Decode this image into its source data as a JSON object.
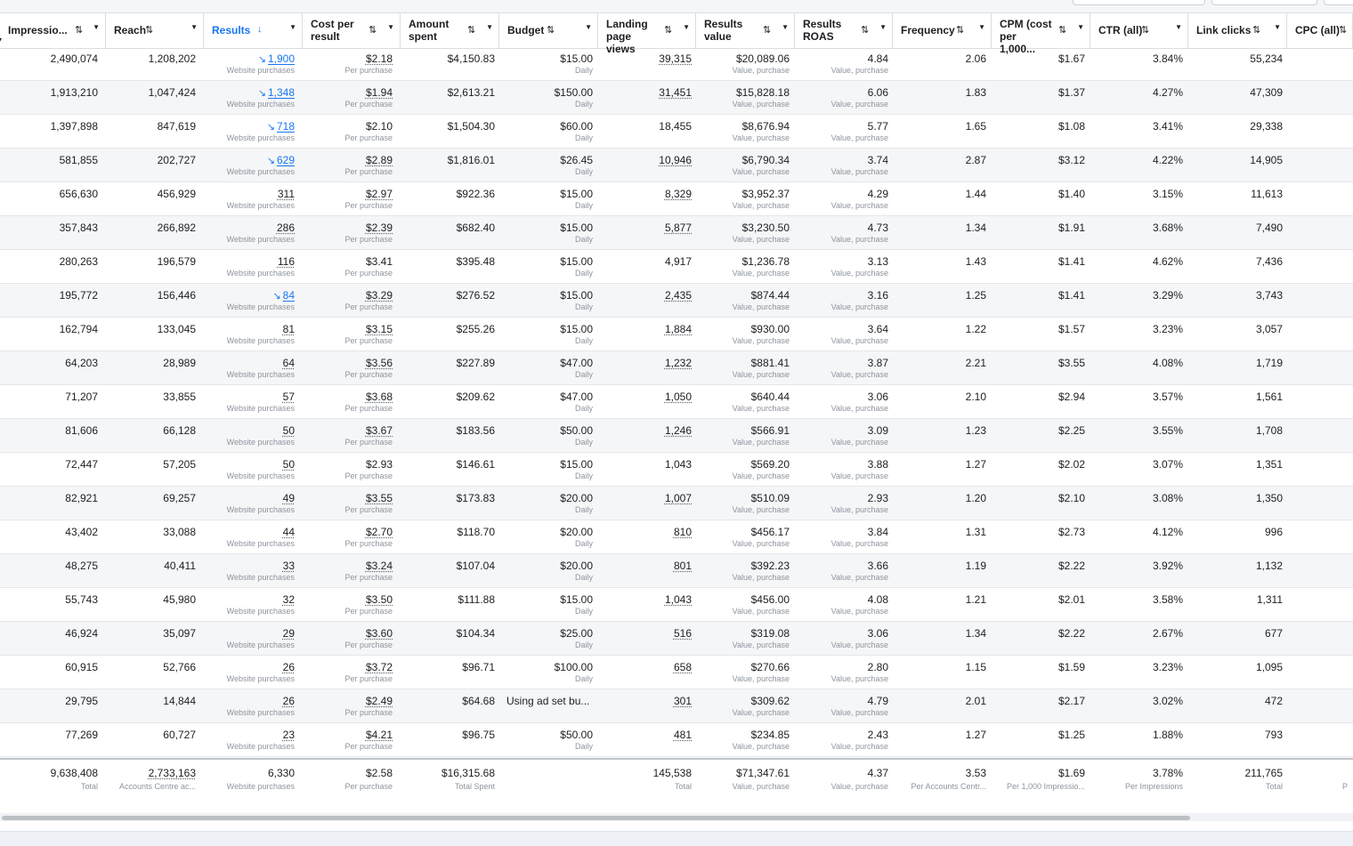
{
  "columns": [
    {
      "label": "Impressio...",
      "sort": "⇅",
      "caret": true
    },
    {
      "label": "Reach",
      "sort": "⇅",
      "caret": true
    },
    {
      "label": "Results",
      "sort": "↓",
      "caret": true,
      "active": true
    },
    {
      "label": "Cost per result",
      "sort": "⇅",
      "caret": true
    },
    {
      "label": "Amount spent",
      "sort": "⇅",
      "caret": true
    },
    {
      "label": "Budget",
      "sort": "⇅",
      "caret": true
    },
    {
      "label": "Landing page views",
      "sort": "⇅",
      "caret": true
    },
    {
      "label": "Results value",
      "sort": "⇅",
      "caret": true
    },
    {
      "label": "Results ROAS",
      "sort": "⇅",
      "caret": true
    },
    {
      "label": "Frequency",
      "sort": "⇅",
      "caret": true
    },
    {
      "label": "CPM (cost per 1,000...",
      "sort": "⇅",
      "caret": true
    },
    {
      "label": "CTR (all)",
      "sort": "⇅",
      "caret": true
    },
    {
      "label": "Link clicks",
      "sort": "⇅",
      "caret": true
    },
    {
      "label": "CPC (all)",
      "sort": "⇅",
      "caret": false
    }
  ],
  "sublabels": {
    "results": "Website purchases",
    "cost_per_result": "Per purchase",
    "budget": "Daily",
    "results_value": "Value, purchase",
    "roas": "Value, purchase"
  },
  "rows": [
    {
      "imp": "2,490,074",
      "reach": "1,208,202",
      "results": "1,900",
      "res_trend": true,
      "res_style": "link",
      "cpr": "$2.18",
      "cpr_dot": true,
      "spent": "$4,150.83",
      "budget": "$15.00",
      "budget_sub": true,
      "lpv": "39,315",
      "lpv_dot": true,
      "value": "$20,089.06",
      "roas": "4.84",
      "freq": "2.06",
      "cpm": "$1.67",
      "ctr": "3.84%",
      "clicks": "55,234"
    },
    {
      "imp": "1,913,210",
      "reach": "1,047,424",
      "results": "1,348",
      "res_trend": true,
      "res_style": "link",
      "cpr": "$1.94",
      "cpr_dot": true,
      "spent": "$2,613.21",
      "budget": "$150.00",
      "budget_sub": true,
      "lpv": "31,451",
      "lpv_dot": true,
      "value": "$15,828.18",
      "roas": "6.06",
      "freq": "1.83",
      "cpm": "$1.37",
      "ctr": "4.27%",
      "clicks": "47,309"
    },
    {
      "imp": "1,397,898",
      "reach": "847,619",
      "results": "718",
      "res_trend": true,
      "res_style": "link",
      "cpr": "$2.10",
      "cpr_dot": false,
      "spent": "$1,504.30",
      "budget": "$60.00",
      "budget_sub": true,
      "lpv": "18,455",
      "lpv_dot": false,
      "value": "$8,676.94",
      "roas": "5.77",
      "freq": "1.65",
      "cpm": "$1.08",
      "ctr": "3.41%",
      "clicks": "29,338"
    },
    {
      "imp": "581,855",
      "reach": "202,727",
      "results": "629",
      "res_trend": true,
      "res_style": "link",
      "cpr": "$2.89",
      "cpr_dot": true,
      "spent": "$1,816.01",
      "budget": "$26.45",
      "budget_sub": true,
      "lpv": "10,946",
      "lpv_dot": true,
      "value": "$6,790.34",
      "roas": "3.74",
      "freq": "2.87",
      "cpm": "$3.12",
      "ctr": "4.22%",
      "clicks": "14,905"
    },
    {
      "imp": "656,630",
      "reach": "456,929",
      "results": "311",
      "res_trend": false,
      "res_style": "dot",
      "cpr": "$2.97",
      "cpr_dot": true,
      "spent": "$922.36",
      "budget": "$15.00",
      "budget_sub": true,
      "lpv": "8,329",
      "lpv_dot": true,
      "value": "$3,952.37",
      "roas": "4.29",
      "freq": "1.44",
      "cpm": "$1.40",
      "ctr": "3.15%",
      "clicks": "11,613"
    },
    {
      "imp": "357,843",
      "reach": "266,892",
      "results": "286",
      "res_trend": false,
      "res_style": "dot",
      "cpr": "$2.39",
      "cpr_dot": true,
      "spent": "$682.40",
      "budget": "$15.00",
      "budget_sub": true,
      "lpv": "5,877",
      "lpv_dot": true,
      "value": "$3,230.50",
      "roas": "4.73",
      "freq": "1.34",
      "cpm": "$1.91",
      "ctr": "3.68%",
      "clicks": "7,490"
    },
    {
      "imp": "280,263",
      "reach": "196,579",
      "results": "116",
      "res_trend": false,
      "res_style": "dot",
      "cpr": "$3.41",
      "cpr_dot": false,
      "spent": "$395.48",
      "budget": "$15.00",
      "budget_sub": true,
      "lpv": "4,917",
      "lpv_dot": false,
      "value": "$1,236.78",
      "roas": "3.13",
      "freq": "1.43",
      "cpm": "$1.41",
      "ctr": "4.62%",
      "clicks": "7,436"
    },
    {
      "imp": "195,772",
      "reach": "156,446",
      "results": "84",
      "res_trend": true,
      "res_style": "link",
      "cpr": "$3.29",
      "cpr_dot": true,
      "spent": "$276.52",
      "budget": "$15.00",
      "budget_sub": true,
      "lpv": "2,435",
      "lpv_dot": true,
      "value": "$874.44",
      "roas": "3.16",
      "freq": "1.25",
      "cpm": "$1.41",
      "ctr": "3.29%",
      "clicks": "3,743"
    },
    {
      "imp": "162,794",
      "reach": "133,045",
      "results": "81",
      "res_trend": false,
      "res_style": "dot",
      "cpr": "$3.15",
      "cpr_dot": true,
      "spent": "$255.26",
      "budget": "$15.00",
      "budget_sub": true,
      "lpv": "1,884",
      "lpv_dot": true,
      "value": "$930.00",
      "roas": "3.64",
      "freq": "1.22",
      "cpm": "$1.57",
      "ctr": "3.23%",
      "clicks": "3,057"
    },
    {
      "imp": "64,203",
      "reach": "28,989",
      "results": "64",
      "res_trend": false,
      "res_style": "dot",
      "cpr": "$3.56",
      "cpr_dot": true,
      "spent": "$227.89",
      "budget": "$47.00",
      "budget_sub": true,
      "lpv": "1,232",
      "lpv_dot": true,
      "value": "$881.41",
      "roas": "3.87",
      "freq": "2.21",
      "cpm": "$3.55",
      "ctr": "4.08%",
      "clicks": "1,719"
    },
    {
      "imp": "71,207",
      "reach": "33,855",
      "results": "57",
      "res_trend": false,
      "res_style": "dot",
      "cpr": "$3.68",
      "cpr_dot": true,
      "spent": "$209.62",
      "budget": "$47.00",
      "budget_sub": true,
      "lpv": "1,050",
      "lpv_dot": true,
      "value": "$640.44",
      "roas": "3.06",
      "freq": "2.10",
      "cpm": "$2.94",
      "ctr": "3.57%",
      "clicks": "1,561"
    },
    {
      "imp": "81,606",
      "reach": "66,128",
      "results": "50",
      "res_trend": false,
      "res_style": "dot",
      "cpr": "$3.67",
      "cpr_dot": true,
      "spent": "$183.56",
      "budget": "$50.00",
      "budget_sub": true,
      "lpv": "1,246",
      "lpv_dot": true,
      "value": "$566.91",
      "roas": "3.09",
      "freq": "1.23",
      "cpm": "$2.25",
      "ctr": "3.55%",
      "clicks": "1,708"
    },
    {
      "imp": "72,447",
      "reach": "57,205",
      "results": "50",
      "res_trend": false,
      "res_style": "dot",
      "cpr": "$2.93",
      "cpr_dot": false,
      "spent": "$146.61",
      "budget": "$15.00",
      "budget_sub": true,
      "lpv": "1,043",
      "lpv_dot": false,
      "value": "$569.20",
      "roas": "3.88",
      "freq": "1.27",
      "cpm": "$2.02",
      "ctr": "3.07%",
      "clicks": "1,351"
    },
    {
      "imp": "82,921",
      "reach": "69,257",
      "results": "49",
      "res_trend": false,
      "res_style": "dot",
      "cpr": "$3.55",
      "cpr_dot": true,
      "spent": "$173.83",
      "budget": "$20.00",
      "budget_sub": true,
      "lpv": "1,007",
      "lpv_dot": true,
      "value": "$510.09",
      "roas": "2.93",
      "freq": "1.20",
      "cpm": "$2.10",
      "ctr": "3.08%",
      "clicks": "1,350"
    },
    {
      "imp": "43,402",
      "reach": "33,088",
      "results": "44",
      "res_trend": false,
      "res_style": "dot",
      "cpr": "$2.70",
      "cpr_dot": true,
      "spent": "$118.70",
      "budget": "$20.00",
      "budget_sub": true,
      "lpv": "810",
      "lpv_dot": true,
      "value": "$456.17",
      "roas": "3.84",
      "freq": "1.31",
      "cpm": "$2.73",
      "ctr": "4.12%",
      "clicks": "996"
    },
    {
      "imp": "48,275",
      "reach": "40,411",
      "results": "33",
      "res_trend": false,
      "res_style": "dot",
      "cpr": "$3.24",
      "cpr_dot": true,
      "spent": "$107.04",
      "budget": "$20.00",
      "budget_sub": true,
      "lpv": "801",
      "lpv_dot": true,
      "value": "$392.23",
      "roas": "3.66",
      "freq": "1.19",
      "cpm": "$2.22",
      "ctr": "3.92%",
      "clicks": "1,132"
    },
    {
      "imp": "55,743",
      "reach": "45,980",
      "results": "32",
      "res_trend": false,
      "res_style": "dot",
      "cpr": "$3.50",
      "cpr_dot": true,
      "spent": "$111.88",
      "budget": "$15.00",
      "budget_sub": true,
      "lpv": "1,043",
      "lpv_dot": true,
      "value": "$456.00",
      "roas": "4.08",
      "freq": "1.21",
      "cpm": "$2.01",
      "ctr": "3.58%",
      "clicks": "1,311"
    },
    {
      "imp": "46,924",
      "reach": "35,097",
      "results": "29",
      "res_trend": false,
      "res_style": "dot",
      "cpr": "$3.60",
      "cpr_dot": true,
      "spent": "$104.34",
      "budget": "$25.00",
      "budget_sub": true,
      "lpv": "516",
      "lpv_dot": true,
      "value": "$319.08",
      "roas": "3.06",
      "freq": "1.34",
      "cpm": "$2.22",
      "ctr": "2.67%",
      "clicks": "677"
    },
    {
      "imp": "60,915",
      "reach": "52,766",
      "results": "26",
      "res_trend": false,
      "res_style": "dot",
      "cpr": "$3.72",
      "cpr_dot": true,
      "spent": "$96.71",
      "budget": "$100.00",
      "budget_sub": true,
      "lpv": "658",
      "lpv_dot": true,
      "value": "$270.66",
      "roas": "2.80",
      "freq": "1.15",
      "cpm": "$1.59",
      "ctr": "3.23%",
      "clicks": "1,095"
    },
    {
      "imp": "29,795",
      "reach": "14,844",
      "results": "26",
      "res_trend": false,
      "res_style": "dot",
      "cpr": "$2.49",
      "cpr_dot": true,
      "spent": "$64.68",
      "budget": "Using ad set bu...",
      "budget_sub": false,
      "budget_left": true,
      "lpv": "301",
      "lpv_dot": true,
      "value": "$309.62",
      "roas": "4.79",
      "freq": "2.01",
      "cpm": "$2.17",
      "ctr": "3.02%",
      "clicks": "472"
    },
    {
      "imp": "77,269",
      "reach": "60,727",
      "results": "23",
      "res_trend": false,
      "res_style": "dot",
      "cpr": "$4.21",
      "cpr_dot": true,
      "spent": "$96.75",
      "budget": "$50.00",
      "budget_sub": true,
      "lpv": "481",
      "lpv_dot": true,
      "value": "$234.85",
      "roas": "2.43",
      "freq": "1.27",
      "cpm": "$1.25",
      "ctr": "1.88%",
      "clicks": "793"
    }
  ],
  "totals": {
    "imp": {
      "value": "9,638,408",
      "sub": "Total"
    },
    "reach": {
      "value": "2,733,163",
      "sub": "Accounts Centre ac..."
    },
    "results": {
      "value": "6,330",
      "sub": "Website purchases"
    },
    "cpr": {
      "value": "$2.58",
      "sub": "Per purchase"
    },
    "spent": {
      "value": "$16,315.68",
      "sub": "Total Spent"
    },
    "budget": {
      "value": "",
      "sub": ""
    },
    "lpv": {
      "value": "145,538",
      "sub": "Total"
    },
    "value": {
      "value": "$71,347.61",
      "sub": "Value, purchase"
    },
    "roas": {
      "value": "4.37",
      "sub": "Value, purchase"
    },
    "freq": {
      "value": "3.53",
      "sub": "Per Accounts Centr..."
    },
    "cpm": {
      "value": "$1.69",
      "sub": "Per 1,000 Impressio..."
    },
    "ctr": {
      "value": "3.78%",
      "sub": "Per Impressions"
    },
    "clicks": {
      "value": "211,765",
      "sub": "Total"
    },
    "cpc": {
      "value": "",
      "sub": "P"
    }
  },
  "colors": {
    "accent": "#1877f2",
    "border": "#dadde1",
    "alt_row": "#f5f6f7",
    "muted": "#8d949e"
  }
}
